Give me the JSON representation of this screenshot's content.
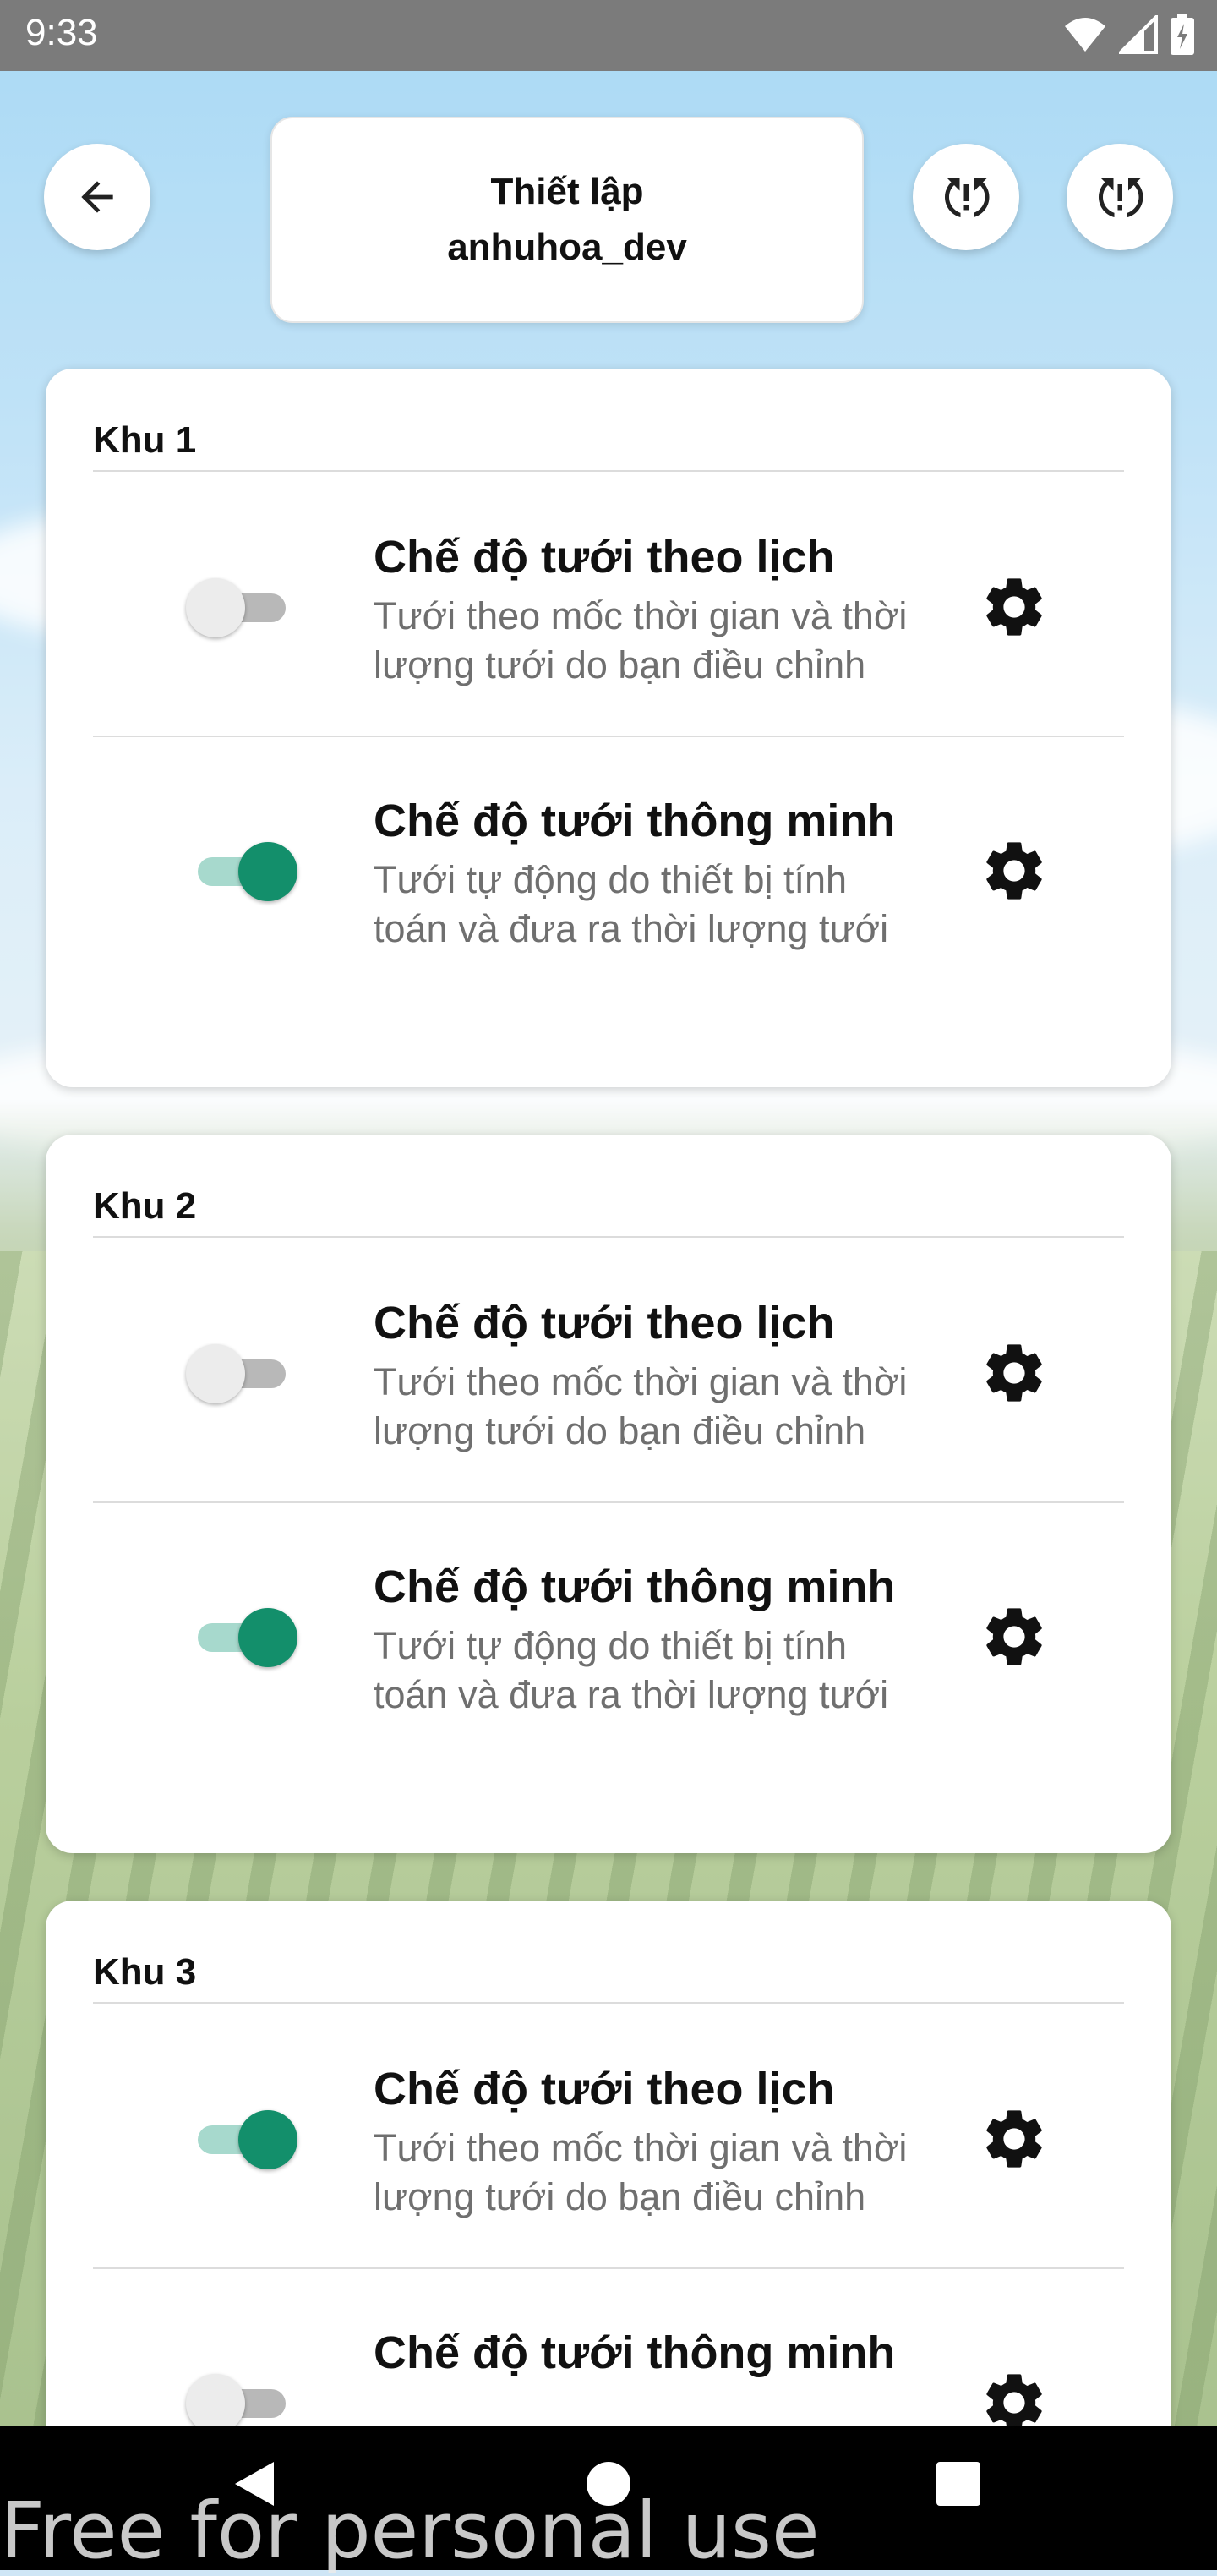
{
  "status_bar": {
    "time": "9:33",
    "icons": [
      "wifi-icon",
      "cell-signal-icon",
      "battery-icon"
    ]
  },
  "header": {
    "back_icon": "arrow-left-icon",
    "title_line1": "Thiết lập",
    "title_line2": "anhuhoa_dev",
    "action_icons": [
      "sync-alert-icon",
      "sync-alert-icon"
    ]
  },
  "zones": [
    {
      "title": "Khu 1",
      "modes": [
        {
          "title": "Chế độ tưới theo lịch",
          "desc_line1": "Tưới theo mốc thời gian và thời",
          "desc_line2": "lượng tưới do bạn điều chỉnh",
          "enabled": false
        },
        {
          "title": "Chế độ tưới thông minh",
          "desc_line1": "Tưới tự động do thiết bị tính",
          "desc_line2": "toán và đưa ra thời lượng tưới",
          "enabled": true
        }
      ]
    },
    {
      "title": "Khu 2",
      "modes": [
        {
          "title": "Chế độ tưới theo lịch",
          "desc_line1": "Tưới theo mốc thời gian và thời",
          "desc_line2": "lượng tưới do bạn điều chỉnh",
          "enabled": false
        },
        {
          "title": "Chế độ tưới thông minh",
          "desc_line1": "Tưới tự động do thiết bị tính",
          "desc_line2": "toán và đưa ra thời lượng tưới",
          "enabled": true
        }
      ]
    },
    {
      "title": "Khu 3",
      "modes": [
        {
          "title": "Chế độ tưới theo lịch",
          "desc_line1": "Tưới theo mốc thời gian và thời",
          "desc_line2": "lượng tưới do bạn điều chỉnh",
          "enabled": true
        },
        {
          "title": "Chế độ tưới thông minh",
          "desc_line1": "",
          "desc_line2": "",
          "enabled": false
        }
      ]
    }
  ],
  "colors": {
    "switch_on": "#138f6b",
    "switch_on_track": "#a7d9cd",
    "switch_off": "#ececec"
  },
  "nav_bar": {
    "icons": [
      "back-triangle-icon",
      "home-circle-icon",
      "recents-square-icon"
    ]
  },
  "watermark": "Free for personal use"
}
